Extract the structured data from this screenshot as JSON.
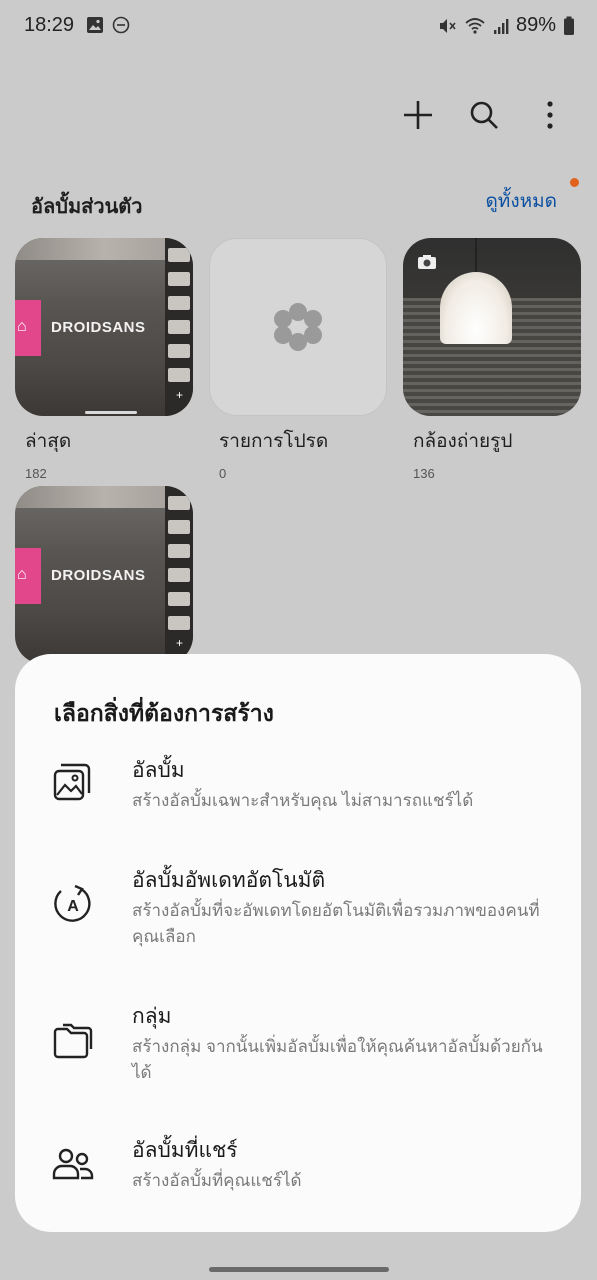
{
  "status": {
    "time": "18:29",
    "battery": "89%"
  },
  "toolbar": {
    "add": "add-icon",
    "search": "search-icon",
    "more": "more-vert-icon"
  },
  "section": {
    "title": "อัลบั้มส่วนตัว",
    "see_all": "ดูทั้งหมด"
  },
  "albums": [
    {
      "name": "ล่าสุด",
      "count": "182",
      "brand": "DROIDSANS"
    },
    {
      "name": "รายการโปรด",
      "count": "0"
    },
    {
      "name": "กล้องถ่ายรูป",
      "count": "136"
    },
    {
      "brand": "DROIDSANS"
    }
  ],
  "sheet": {
    "title": "เลือกสิ่งที่ต้องการสร้าง",
    "options": [
      {
        "title": "อัลบั้ม",
        "desc": "สร้างอัลบั้มเฉพาะสำหรับคุณ ไม่สามารถแชร์ได้",
        "icon": "album-icon"
      },
      {
        "title": "อัลบั้มอัพเดทอัตโนมัติ",
        "desc": "สร้างอัลบั้มที่จะอัพเดทโดยอัตโนมัติเพื่อรวมภาพของคนที่คุณเลือก",
        "icon": "auto-update-icon"
      },
      {
        "title": "กลุ่ม",
        "desc": "สร้างกลุ่ม จากนั้นเพิ่มอัลบั้มเพื่อให้คุณค้นหาอัลบั้มด้วยกันได้",
        "icon": "folder-icon"
      },
      {
        "title": "อัลบั้มที่แชร์",
        "desc": "สร้างอัลบั้มที่คุณแชร์ได้",
        "icon": "shared-people-icon"
      }
    ]
  },
  "colors": {
    "accent": "#0b4fa0",
    "notification_dot": "#e0621c",
    "favorite": "#9a9a9a"
  }
}
